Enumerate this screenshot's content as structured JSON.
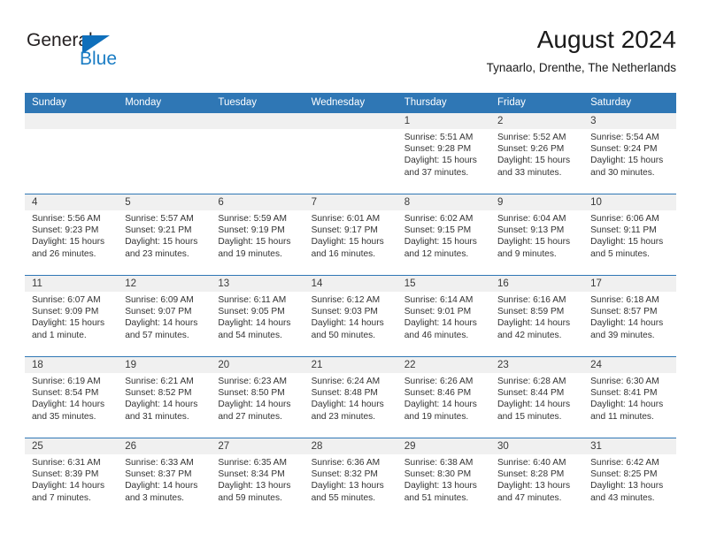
{
  "logo": {
    "word_top": "General",
    "word_bottom": "Blue",
    "triangle_color": "#0f6fbb",
    "blue_color": "#1b7dc4"
  },
  "header": {
    "title": "August 2024",
    "subtitle": "Tynaarlo, Drenthe, The Netherlands"
  },
  "theme": {
    "header_blue": "#2f77b5",
    "daynum_band": "#f0f0f0",
    "text": "#333333"
  },
  "weekdays": [
    "Sunday",
    "Monday",
    "Tuesday",
    "Wednesday",
    "Thursday",
    "Friday",
    "Saturday"
  ],
  "weeks": [
    [
      {
        "day": "",
        "lines": []
      },
      {
        "day": "",
        "lines": []
      },
      {
        "day": "",
        "lines": []
      },
      {
        "day": "",
        "lines": []
      },
      {
        "day": "1",
        "lines": [
          "Sunrise: 5:51 AM",
          "Sunset: 9:28 PM",
          "Daylight: 15 hours",
          "and 37 minutes."
        ]
      },
      {
        "day": "2",
        "lines": [
          "Sunrise: 5:52 AM",
          "Sunset: 9:26 PM",
          "Daylight: 15 hours",
          "and 33 minutes."
        ]
      },
      {
        "day": "3",
        "lines": [
          "Sunrise: 5:54 AM",
          "Sunset: 9:24 PM",
          "Daylight: 15 hours",
          "and 30 minutes."
        ]
      }
    ],
    [
      {
        "day": "4",
        "lines": [
          "Sunrise: 5:56 AM",
          "Sunset: 9:23 PM",
          "Daylight: 15 hours",
          "and 26 minutes."
        ]
      },
      {
        "day": "5",
        "lines": [
          "Sunrise: 5:57 AM",
          "Sunset: 9:21 PM",
          "Daylight: 15 hours",
          "and 23 minutes."
        ]
      },
      {
        "day": "6",
        "lines": [
          "Sunrise: 5:59 AM",
          "Sunset: 9:19 PM",
          "Daylight: 15 hours",
          "and 19 minutes."
        ]
      },
      {
        "day": "7",
        "lines": [
          "Sunrise: 6:01 AM",
          "Sunset: 9:17 PM",
          "Daylight: 15 hours",
          "and 16 minutes."
        ]
      },
      {
        "day": "8",
        "lines": [
          "Sunrise: 6:02 AM",
          "Sunset: 9:15 PM",
          "Daylight: 15 hours",
          "and 12 minutes."
        ]
      },
      {
        "day": "9",
        "lines": [
          "Sunrise: 6:04 AM",
          "Sunset: 9:13 PM",
          "Daylight: 15 hours",
          "and 9 minutes."
        ]
      },
      {
        "day": "10",
        "lines": [
          "Sunrise: 6:06 AM",
          "Sunset: 9:11 PM",
          "Daylight: 15 hours",
          "and 5 minutes."
        ]
      }
    ],
    [
      {
        "day": "11",
        "lines": [
          "Sunrise: 6:07 AM",
          "Sunset: 9:09 PM",
          "Daylight: 15 hours",
          "and 1 minute."
        ]
      },
      {
        "day": "12",
        "lines": [
          "Sunrise: 6:09 AM",
          "Sunset: 9:07 PM",
          "Daylight: 14 hours",
          "and 57 minutes."
        ]
      },
      {
        "day": "13",
        "lines": [
          "Sunrise: 6:11 AM",
          "Sunset: 9:05 PM",
          "Daylight: 14 hours",
          "and 54 minutes."
        ]
      },
      {
        "day": "14",
        "lines": [
          "Sunrise: 6:12 AM",
          "Sunset: 9:03 PM",
          "Daylight: 14 hours",
          "and 50 minutes."
        ]
      },
      {
        "day": "15",
        "lines": [
          "Sunrise: 6:14 AM",
          "Sunset: 9:01 PM",
          "Daylight: 14 hours",
          "and 46 minutes."
        ]
      },
      {
        "day": "16",
        "lines": [
          "Sunrise: 6:16 AM",
          "Sunset: 8:59 PM",
          "Daylight: 14 hours",
          "and 42 minutes."
        ]
      },
      {
        "day": "17",
        "lines": [
          "Sunrise: 6:18 AM",
          "Sunset: 8:57 PM",
          "Daylight: 14 hours",
          "and 39 minutes."
        ]
      }
    ],
    [
      {
        "day": "18",
        "lines": [
          "Sunrise: 6:19 AM",
          "Sunset: 8:54 PM",
          "Daylight: 14 hours",
          "and 35 minutes."
        ]
      },
      {
        "day": "19",
        "lines": [
          "Sunrise: 6:21 AM",
          "Sunset: 8:52 PM",
          "Daylight: 14 hours",
          "and 31 minutes."
        ]
      },
      {
        "day": "20",
        "lines": [
          "Sunrise: 6:23 AM",
          "Sunset: 8:50 PM",
          "Daylight: 14 hours",
          "and 27 minutes."
        ]
      },
      {
        "day": "21",
        "lines": [
          "Sunrise: 6:24 AM",
          "Sunset: 8:48 PM",
          "Daylight: 14 hours",
          "and 23 minutes."
        ]
      },
      {
        "day": "22",
        "lines": [
          "Sunrise: 6:26 AM",
          "Sunset: 8:46 PM",
          "Daylight: 14 hours",
          "and 19 minutes."
        ]
      },
      {
        "day": "23",
        "lines": [
          "Sunrise: 6:28 AM",
          "Sunset: 8:44 PM",
          "Daylight: 14 hours",
          "and 15 minutes."
        ]
      },
      {
        "day": "24",
        "lines": [
          "Sunrise: 6:30 AM",
          "Sunset: 8:41 PM",
          "Daylight: 14 hours",
          "and 11 minutes."
        ]
      }
    ],
    [
      {
        "day": "25",
        "lines": [
          "Sunrise: 6:31 AM",
          "Sunset: 8:39 PM",
          "Daylight: 14 hours",
          "and 7 minutes."
        ]
      },
      {
        "day": "26",
        "lines": [
          "Sunrise: 6:33 AM",
          "Sunset: 8:37 PM",
          "Daylight: 14 hours",
          "and 3 minutes."
        ]
      },
      {
        "day": "27",
        "lines": [
          "Sunrise: 6:35 AM",
          "Sunset: 8:34 PM",
          "Daylight: 13 hours",
          "and 59 minutes."
        ]
      },
      {
        "day": "28",
        "lines": [
          "Sunrise: 6:36 AM",
          "Sunset: 8:32 PM",
          "Daylight: 13 hours",
          "and 55 minutes."
        ]
      },
      {
        "day": "29",
        "lines": [
          "Sunrise: 6:38 AM",
          "Sunset: 8:30 PM",
          "Daylight: 13 hours",
          "and 51 minutes."
        ]
      },
      {
        "day": "30",
        "lines": [
          "Sunrise: 6:40 AM",
          "Sunset: 8:28 PM",
          "Daylight: 13 hours",
          "and 47 minutes."
        ]
      },
      {
        "day": "31",
        "lines": [
          "Sunrise: 6:42 AM",
          "Sunset: 8:25 PM",
          "Daylight: 13 hours",
          "and 43 minutes."
        ]
      }
    ]
  ]
}
